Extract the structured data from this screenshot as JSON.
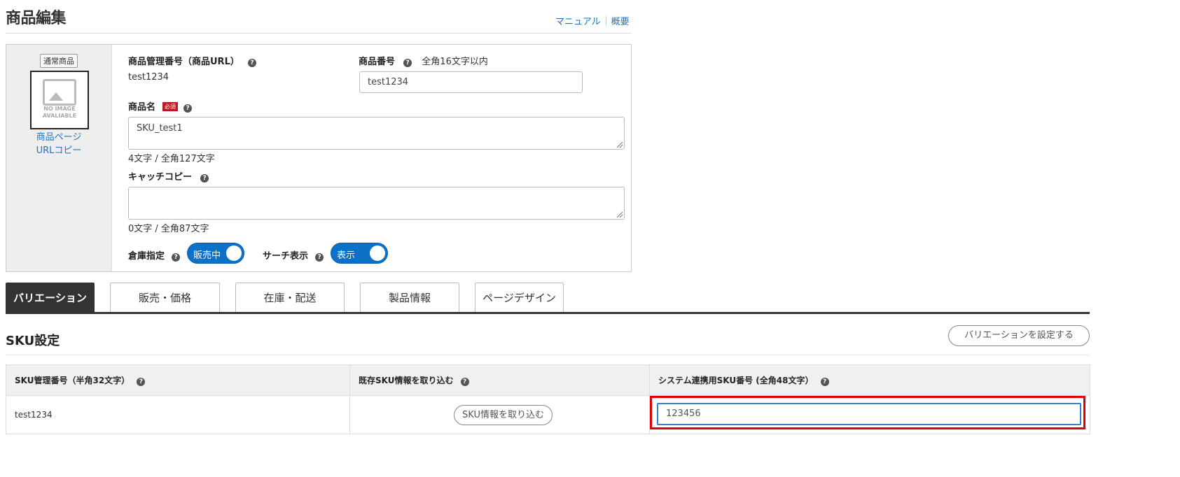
{
  "header": {
    "title": "商品編集",
    "link_manual": "マニュアル",
    "link_overview": "概要"
  },
  "product": {
    "badge": "通常商品",
    "thumb_text_1": "NO IMAGE",
    "thumb_text_2": "AVALIABLE",
    "copy_link_1": "商品ページ",
    "copy_link_2": "URLコピー",
    "mgmt_label": "商品管理番号（商品URL）",
    "mgmt_value": "test1234",
    "number_label": "商品番号",
    "number_hint": "全角16文字以内",
    "number_value": "test1234",
    "name_label": "商品名",
    "required_badge": "必須",
    "name_value": "SKU_test1",
    "name_counter": "4文字 / 全角127文字",
    "catch_label": "キャッチコピー",
    "catch_value": "",
    "catch_counter": "0文字 / 全角87文字",
    "warehouse_label": "倉庫指定",
    "warehouse_toggle": "販売中",
    "search_label": "サーチ表示",
    "search_toggle": "表示"
  },
  "tabs": [
    {
      "label": "バリエーション",
      "active": true
    },
    {
      "label": "販売・価格",
      "active": false
    },
    {
      "label": "在庫・配送",
      "active": false
    },
    {
      "label": "製品情報",
      "active": false
    },
    {
      "label": "ページデザイン",
      "active": false
    }
  ],
  "sku": {
    "title": "SKU設定",
    "set_variation_button": "バリエーションを設定する",
    "columns": [
      "SKU管理番号（半角32文字）",
      "既存SKU情報を取り込む",
      "システム連携用SKU番号 (全角48文字）"
    ],
    "row": {
      "mgmt_number": "test1234",
      "import_button": "SKU情報を取り込む",
      "system_sku": "123456"
    }
  },
  "colors": {
    "accent_blue": "#0d72c7",
    "link_blue": "#1a73c8",
    "required_red": "#c0161f",
    "highlight_red": "#e00000",
    "tab_active": "#333333"
  }
}
